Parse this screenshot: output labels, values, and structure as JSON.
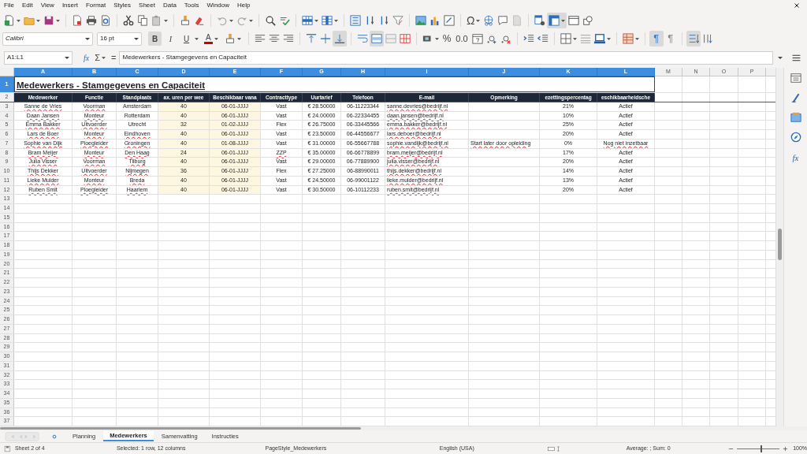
{
  "menu": [
    "File",
    "Edit",
    "View",
    "Insert",
    "Format",
    "Styles",
    "Sheet",
    "Data",
    "Tools",
    "Window",
    "Help"
  ],
  "standard_toolbar": {
    "symbol_label": "Ω",
    "freeze_pressed": true
  },
  "format_toolbar": {
    "font_name": "Calibri",
    "font_size": "16 pt",
    "style_buttons": [
      {
        "label": "B",
        "pressed": true
      },
      {
        "label": "I",
        "pressed": false
      },
      {
        "label": "U",
        "pressed": false
      }
    ],
    "font_color_label": "A",
    "align_bottom_pressed": true,
    "merge_pressed": true,
    "percent_label": "%",
    "number_label": "0.0",
    "paragraph_buttons": [
      {
        "label": "¶",
        "pressed": true
      },
      {
        "label": "¶",
        "pressed": false
      }
    ],
    "vertical_text_pressed": true
  },
  "formula_bar": {
    "name_box": "A1:L1",
    "function_label": "fx",
    "sum_label": "Σ",
    "equals_label": "=",
    "content": "Medewerkers - Stamgegevens en Capaciteit"
  },
  "columns": [
    {
      "label": "A",
      "selected": true
    },
    {
      "label": "B",
      "selected": true
    },
    {
      "label": "C",
      "selected": true
    },
    {
      "label": "D",
      "selected": true
    },
    {
      "label": "E",
      "selected": true
    },
    {
      "label": "F",
      "selected": true
    },
    {
      "label": "G",
      "selected": true
    },
    {
      "label": "H",
      "selected": true
    },
    {
      "label": "I",
      "selected": true
    },
    {
      "label": "J",
      "selected": true
    },
    {
      "label": "K",
      "selected": true
    },
    {
      "label": "L",
      "selected": true
    },
    {
      "label": "M",
      "selected": false
    },
    {
      "label": "N",
      "selected": false
    },
    {
      "label": "O",
      "selected": false
    },
    {
      "label": "P",
      "selected": false
    }
  ],
  "row_headers": [
    {
      "label": "1",
      "selected": true
    },
    {
      "label": "2",
      "selected": false
    },
    {
      "label": "3",
      "selected": false
    },
    {
      "label": "4",
      "selected": false
    },
    {
      "label": "5",
      "selected": false
    },
    {
      "label": "6",
      "selected": false
    },
    {
      "label": "7",
      "selected": false
    },
    {
      "label": "8",
      "selected": false
    },
    {
      "label": "9",
      "selected": false
    },
    {
      "label": "10",
      "selected": false
    },
    {
      "label": "11",
      "selected": false
    },
    {
      "label": "12",
      "selected": false
    },
    {
      "label": "13",
      "selected": false
    },
    {
      "label": "14",
      "selected": false
    },
    {
      "label": "15",
      "selected": false
    },
    {
      "label": "16",
      "selected": false
    },
    {
      "label": "17",
      "selected": false
    },
    {
      "label": "18",
      "selected": false
    },
    {
      "label": "19",
      "selected": false
    },
    {
      "label": "20",
      "selected": false
    },
    {
      "label": "21",
      "selected": false
    },
    {
      "label": "22",
      "selected": false
    },
    {
      "label": "23",
      "selected": false
    },
    {
      "label": "24",
      "selected": false
    },
    {
      "label": "25",
      "selected": false
    },
    {
      "label": "26",
      "selected": false
    },
    {
      "label": "27",
      "selected": false
    },
    {
      "label": "28",
      "selected": false
    },
    {
      "label": "29",
      "selected": false
    },
    {
      "label": "30",
      "selected": false
    },
    {
      "label": "31",
      "selected": false
    },
    {
      "label": "32",
      "selected": false
    },
    {
      "label": "33",
      "selected": false
    },
    {
      "label": "34",
      "selected": false
    },
    {
      "label": "35",
      "selected": false
    },
    {
      "label": "36",
      "selected": false
    },
    {
      "label": "37",
      "selected": false
    }
  ],
  "sheet": {
    "title": "Medewerkers - Stamgegevens en Capaciteit",
    "header_row": [
      "Medewerker",
      "Functie",
      "Standplaats",
      "ax. uren per wee",
      "Beschikbaar vana",
      "Contracttype",
      "Uurtarief",
      "Telefoon",
      "E-mail",
      "Opmerking",
      "ezettingspercentag",
      "eschikbaarheidsche"
    ],
    "rows": [
      {
        "cells": [
          {
            "text": "Sanne de Vries",
            "flagged": true
          },
          {
            "text": "Voorman",
            "flagged": true
          },
          {
            "text": "Amsterdam",
            "flagged": false
          },
          {
            "text": "40",
            "flagged": false
          },
          {
            "text": "06-01-JJJJ",
            "flagged": false
          },
          {
            "text": "Vast",
            "flagged": false
          },
          {
            "text": "€ 28.50000",
            "flagged": false
          },
          {
            "text": "06-11223344",
            "flagged": false
          },
          {
            "text": "sanne.devries@bedrijf.nl",
            "flagged": true
          },
          null,
          {
            "text": "21%",
            "flagged": false
          },
          {
            "text": "Actief",
            "flagged": false
          }
        ]
      },
      {
        "cells": [
          {
            "text": "Daan Jansen",
            "flagged": true
          },
          {
            "text": "Monteur",
            "flagged": true
          },
          {
            "text": "Rotterdam",
            "flagged": false
          },
          {
            "text": "40",
            "flagged": false
          },
          {
            "text": "06-01-JJJJ",
            "flagged": false
          },
          {
            "text": "Vast",
            "flagged": false
          },
          {
            "text": "€ 24.00000",
            "flagged": false
          },
          {
            "text": "06-22334455",
            "flagged": false
          },
          {
            "text": "daan.jansen@bedrijf.nl",
            "flagged": true
          },
          null,
          {
            "text": "10%",
            "flagged": false
          },
          {
            "text": "Actief",
            "flagged": false
          }
        ]
      },
      {
        "cells": [
          {
            "text": "Emma Bakker",
            "flagged": true
          },
          {
            "text": "Uitvoerder",
            "flagged": true
          },
          {
            "text": "Utrecht",
            "flagged": false
          },
          {
            "text": "32",
            "flagged": false
          },
          {
            "text": "01-02-JJJJ",
            "flagged": false
          },
          {
            "text": "Flex",
            "flagged": false
          },
          {
            "text": "€ 26.75000",
            "flagged": false
          },
          {
            "text": "06-33445566",
            "flagged": false
          },
          {
            "text": "emma.bakker@bedrijf.nl",
            "flagged": true
          },
          null,
          {
            "text": "25%",
            "flagged": false
          },
          {
            "text": "Actief",
            "flagged": false
          }
        ]
      },
      {
        "cells": [
          {
            "text": "Lars de Boer",
            "flagged": true
          },
          {
            "text": "Monteur",
            "flagged": true
          },
          {
            "text": "Eindhoven",
            "flagged": true
          },
          {
            "text": "40",
            "flagged": false
          },
          {
            "text": "06-01-JJJJ",
            "flagged": false
          },
          {
            "text": "Vast",
            "flagged": false
          },
          {
            "text": "€ 23.50000",
            "flagged": false
          },
          {
            "text": "06-44556677",
            "flagged": false
          },
          {
            "text": "lars.deboer@bedrijf.nl",
            "flagged": true
          },
          null,
          {
            "text": "20%",
            "flagged": false
          },
          {
            "text": "Actief",
            "flagged": false
          }
        ]
      },
      {
        "cells": [
          {
            "text": "Sophie van Dijk",
            "flagged": true
          },
          {
            "text": "Ploegleider",
            "flagged": true
          },
          {
            "text": "Groningen",
            "flagged": true
          },
          {
            "text": "40",
            "flagged": false
          },
          {
            "text": "01-08-JJJJ",
            "flagged": false
          },
          {
            "text": "Vast",
            "flagged": false
          },
          {
            "text": "€ 31.00000",
            "flagged": false
          },
          {
            "text": "06-55667788",
            "flagged": false
          },
          {
            "text": "sophie.vandijk@bedrijf.nl",
            "flagged": true
          },
          {
            "text": "Start later door opleiding",
            "flagged": true
          },
          {
            "text": "0%",
            "flagged": false
          },
          {
            "text": "Nog niet inzetbaar",
            "flagged": true
          }
        ]
      },
      {
        "cells": [
          {
            "text": "Bram Meijer",
            "flagged": true
          },
          {
            "text": "Monteur",
            "flagged": true
          },
          {
            "text": "Den Haag",
            "flagged": true
          },
          {
            "text": "24",
            "flagged": false
          },
          {
            "text": "06-01-JJJJ",
            "flagged": false
          },
          {
            "text": "ZZP",
            "flagged": true
          },
          {
            "text": "€ 35.00000",
            "flagged": false
          },
          {
            "text": "06-66778899",
            "flagged": false
          },
          {
            "text": "bram.meijer@bedrijf.nl",
            "flagged": true
          },
          null,
          {
            "text": "17%",
            "flagged": false
          },
          {
            "text": "Actief",
            "flagged": false
          }
        ]
      },
      {
        "cells": [
          {
            "text": "Julia Visser",
            "flagged": true
          },
          {
            "text": "Voorman",
            "flagged": true
          },
          {
            "text": "Tilburg",
            "flagged": true
          },
          {
            "text": "40",
            "flagged": false
          },
          {
            "text": "06-01-JJJJ",
            "flagged": false
          },
          {
            "text": "Vast",
            "flagged": false
          },
          {
            "text": "€ 29.00000",
            "flagged": false
          },
          {
            "text": "06-77889900",
            "flagged": false
          },
          {
            "text": "julia.visser@bedrijf.nl",
            "flagged": true
          },
          null,
          {
            "text": "20%",
            "flagged": false
          },
          {
            "text": "Actief",
            "flagged": false
          }
        ]
      },
      {
        "cells": [
          {
            "text": "Thijs Dekker",
            "flagged": true
          },
          {
            "text": "Uitvoerder",
            "flagged": true
          },
          {
            "text": "Nijmegen",
            "flagged": true
          },
          {
            "text": "36",
            "flagged": false
          },
          {
            "text": "06-01-JJJJ",
            "flagged": false
          },
          {
            "text": "Flex",
            "flagged": false
          },
          {
            "text": "€ 27.25000",
            "flagged": false
          },
          {
            "text": "06-88990011",
            "flagged": false
          },
          {
            "text": "thijs.dekker@bedrijf.nl",
            "flagged": true
          },
          null,
          {
            "text": "14%",
            "flagged": false
          },
          {
            "text": "Actief",
            "flagged": false
          }
        ]
      },
      {
        "cells": [
          {
            "text": "Lieke Mulder",
            "flagged": true
          },
          {
            "text": "Monteur",
            "flagged": true
          },
          {
            "text": "Breda",
            "flagged": true
          },
          {
            "text": "40",
            "flagged": false
          },
          {
            "text": "06-01-JJJJ",
            "flagged": false
          },
          {
            "text": "Vast",
            "flagged": false
          },
          {
            "text": "€ 24.50000",
            "flagged": false
          },
          {
            "text": "06-99001122",
            "flagged": false
          },
          {
            "text": "lieke.mulder@bedrijf.nl",
            "flagged": true
          },
          null,
          {
            "text": "13%",
            "flagged": false
          },
          {
            "text": "Actief",
            "flagged": false
          }
        ]
      },
      {
        "cells": [
          {
            "text": "Ruben Smit",
            "flagged": true
          },
          {
            "text": "Ploegleider",
            "flagged": true
          },
          {
            "text": "Haarlem",
            "flagged": true
          },
          {
            "text": "40",
            "flagged": false
          },
          {
            "text": "06-01-JJJJ",
            "flagged": false
          },
          {
            "text": "Vast",
            "flagged": false
          },
          {
            "text": "€ 30.50000",
            "flagged": false
          },
          {
            "text": "06-10112233",
            "flagged": false
          },
          {
            "text": "ruben.smit@bedrijf.nl",
            "flagged": true
          },
          null,
          {
            "text": "20%",
            "flagged": false
          },
          {
            "text": "Actief",
            "flagged": false
          }
        ]
      }
    ]
  },
  "sheet_tabs": [
    {
      "label": "Planning",
      "selected": false
    },
    {
      "label": "Medewerkers",
      "selected": true
    },
    {
      "label": "Samenvatting",
      "selected": false
    },
    {
      "label": "Instructies",
      "selected": false
    }
  ],
  "sidebar": {
    "functions_label": "fx"
  },
  "status_bar": {
    "sheet": "Sheet 2 of 4",
    "selection": "Selected: 1 row, 12 columns",
    "page_style": "PageStyle_Medewerkers",
    "language": "English (USA)",
    "summary": "Average: ; Sum: 0",
    "zoom": "100%",
    "zoom_level": {
      "level": 0.55
    }
  }
}
